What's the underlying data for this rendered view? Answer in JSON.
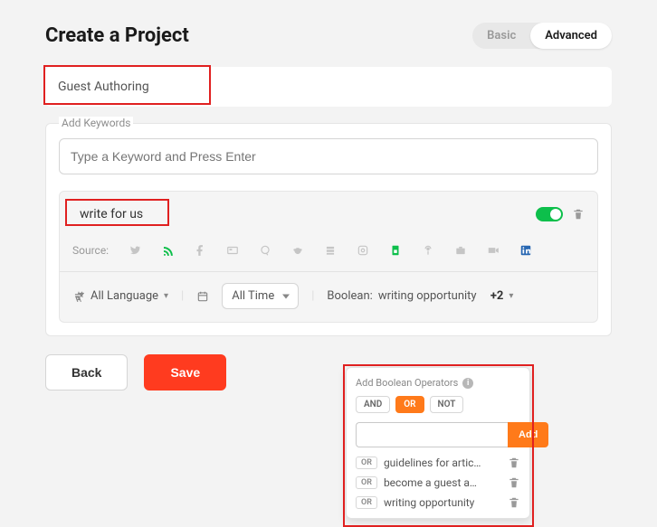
{
  "header": {
    "title": "Create a Project",
    "mode_basic": "Basic",
    "mode_advanced": "Advanced"
  },
  "project_name": "Guest Authoring",
  "keywords": {
    "section_label": "Add Keywords",
    "input_placeholder": "Type a Keyword and Press Enter",
    "card": {
      "term": "write for us",
      "toggle_on": true,
      "source_label": "Source:",
      "sources": [
        {
          "name": "twitter",
          "active": false
        },
        {
          "name": "rss",
          "active": true
        },
        {
          "name": "facebook",
          "active": false
        },
        {
          "name": "news",
          "active": false
        },
        {
          "name": "quora",
          "active": false
        },
        {
          "name": "reddit",
          "active": false
        },
        {
          "name": "stackexchange",
          "active": false
        },
        {
          "name": "instagram",
          "active": false
        },
        {
          "name": "sheet",
          "active": true
        },
        {
          "name": "podcast",
          "active": false
        },
        {
          "name": "briefcase",
          "active": false
        },
        {
          "name": "video",
          "active": false
        },
        {
          "name": "linkedin",
          "active": false,
          "blue": true
        }
      ],
      "language_label": "All Language",
      "time_label": "All Time",
      "boolean_label": "Boolean:",
      "boolean_summary": "writing opportunity",
      "boolean_extra": "+2"
    }
  },
  "boolean_panel": {
    "title": "Add Boolean Operators",
    "ops": {
      "and": "AND",
      "or": "OR",
      "not": "NOT"
    },
    "selected_op": "OR",
    "add_button": "Add",
    "items": [
      {
        "op": "OR",
        "text": "guidelines for artic…"
      },
      {
        "op": "OR",
        "text": "become a guest a…"
      },
      {
        "op": "OR",
        "text": "writing opportunity"
      }
    ]
  },
  "actions": {
    "back": "Back",
    "save": "Save"
  }
}
